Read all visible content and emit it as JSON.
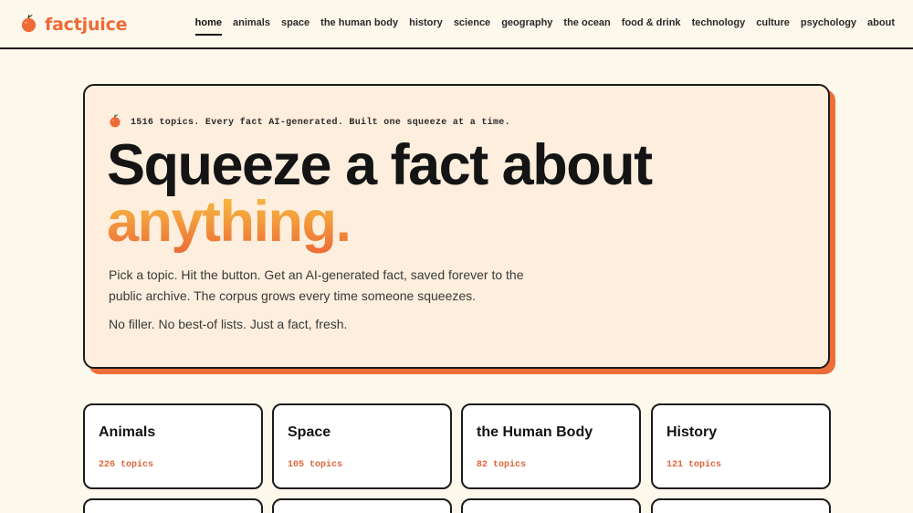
{
  "brand": {
    "name": "factjuice",
    "icon": "orange-fruit-icon",
    "accent_color": "#ef6a36"
  },
  "nav": {
    "active": "home",
    "items": [
      {
        "label": "home"
      },
      {
        "label": "animals"
      },
      {
        "label": "space"
      },
      {
        "label": "the human body"
      },
      {
        "label": "history"
      },
      {
        "label": "science"
      },
      {
        "label": "geography"
      },
      {
        "label": "the ocean"
      },
      {
        "label": "food & drink"
      },
      {
        "label": "technology"
      },
      {
        "label": "culture"
      },
      {
        "label": "psychology"
      },
      {
        "label": "about"
      }
    ]
  },
  "hero": {
    "tagline": "1516 topics. Every fact AI-generated. Built one squeeze at a time.",
    "headline_line1": "Squeeze a fact about",
    "headline_line2": "anything.",
    "body_1": "Pick a topic. Hit the button. Get an AI-generated fact, saved forever to the public archive. The corpus grows every time someone squeezes.",
    "body_2": "No filler. No best-of lists. Just a fact, fresh."
  },
  "topics": [
    {
      "title": "Animals",
      "count": "226 topics"
    },
    {
      "title": "Space",
      "count": "105 topics"
    },
    {
      "title": "the Human Body",
      "count": "82 topics"
    },
    {
      "title": "History",
      "count": "121 topics"
    }
  ]
}
